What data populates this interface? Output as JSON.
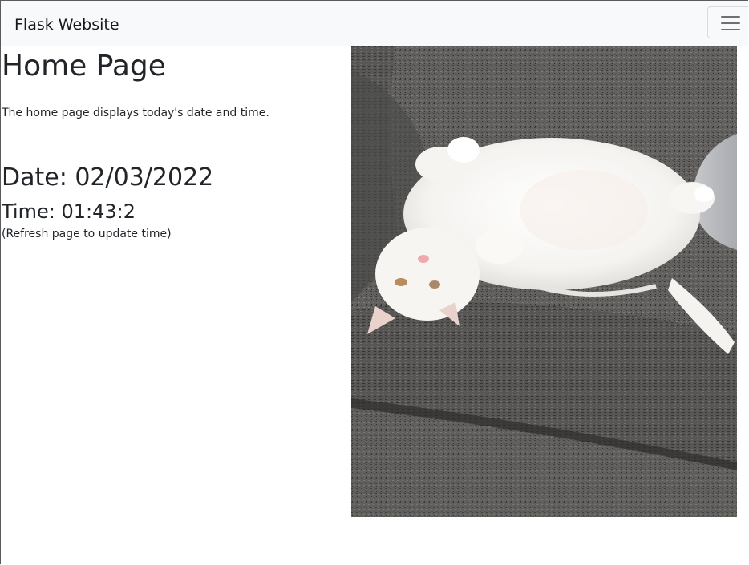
{
  "navbar": {
    "brand": "Flask Website",
    "toggler_icon": "hamburger-menu-icon"
  },
  "main": {
    "title": "Home Page",
    "description": "The home page displays today's date and time.",
    "date_text": "Date: 02/03/2022",
    "time_text": "Time: 01:43:2",
    "refresh_note": "(Refresh page to update time)"
  },
  "image": {
    "subject": "white cat lying on its back on a gray couch"
  },
  "colors": {
    "navbar_bg": "#f8f9fa",
    "text": "#212529",
    "couch": "#5f5e5c"
  }
}
